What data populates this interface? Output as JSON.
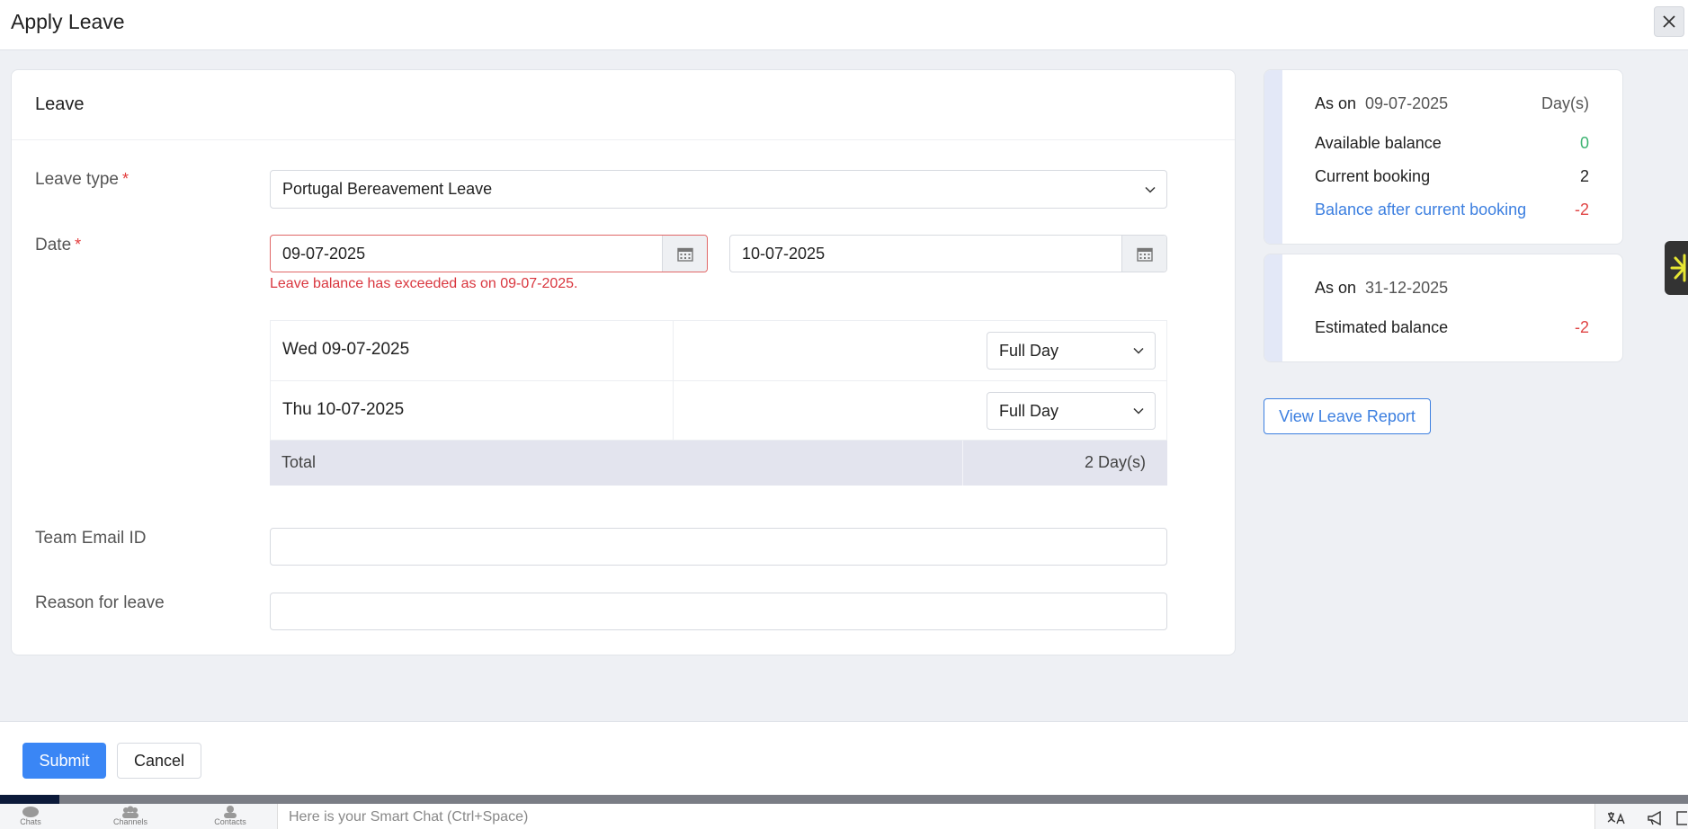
{
  "dialog": {
    "title": "Apply Leave"
  },
  "panel": {
    "title": "Leave"
  },
  "form": {
    "leave_type_label": "Leave type",
    "leave_type_value": "Portugal Bereavement Leave",
    "date_label": "Date",
    "from_date": "09-07-2025",
    "to_date": "10-07-2025",
    "error": "Leave balance has exceeded as on 09-07-2025.",
    "days": [
      {
        "label": "Wed 09-07-2025",
        "type": "Full Day"
      },
      {
        "label": "Thu 10-07-2025",
        "type": "Full Day"
      }
    ],
    "total_label": "Total",
    "total_value": "2 Day(s)",
    "team_email_label": "Team Email ID",
    "team_email_value": "",
    "reason_label": "Reason for leave",
    "reason_value": ""
  },
  "balance_card": {
    "as_on_label": "As on",
    "as_on_date": "09-07-2025",
    "unit": "Day(s)",
    "available_label": "Available balance",
    "available_value": "0",
    "current_label": "Current booking",
    "current_value": "2",
    "after_label": "Balance after current booking",
    "after_value": "-2"
  },
  "estimate_card": {
    "as_on_label": "As on",
    "as_on_date": "31-12-2025",
    "estimated_label": "Estimated balance",
    "estimated_value": "-2"
  },
  "view_report_label": "View Leave Report",
  "footer": {
    "submit_label": "Submit",
    "cancel_label": "Cancel"
  },
  "bottombar": {
    "chats_label": "Chats",
    "channels_label": "Channels",
    "contacts_label": "Contacts",
    "smartchat_placeholder": "Here is your Smart Chat (Ctrl+Space)"
  },
  "progress_fraction": 0.035,
  "colors": {
    "primary": "#3a86f5",
    "error": "#e04545",
    "success": "#3cb371",
    "link": "#3c7fe0"
  }
}
